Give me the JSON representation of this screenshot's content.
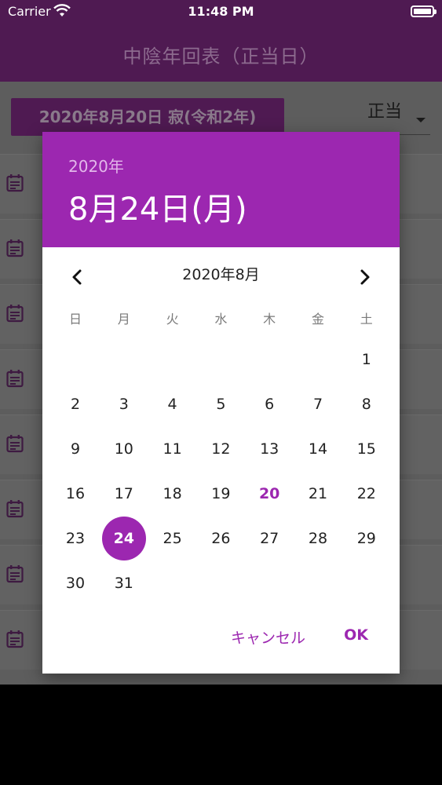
{
  "status_bar": {
    "carrier": "Carrier",
    "time": "11:48 PM"
  },
  "app_bar": {
    "title": "中陰年回表（正当日）"
  },
  "screen": {
    "date_button_label": "2020年8月20日 寂(令和2年)",
    "mode_select": {
      "selected": "正当"
    },
    "list_card_count": 8
  },
  "dialog": {
    "header_year": "2020年",
    "header_date": "8月24日(月)",
    "month_label": "2020年8月",
    "weekdays": [
      "日",
      "月",
      "火",
      "水",
      "木",
      "金",
      "土"
    ],
    "first_weekday_index": 6,
    "days_in_month": 31,
    "today": 20,
    "selected": 24,
    "cancel_label": "キャンセル",
    "ok_label": "OK"
  },
  "colors": {
    "primary": "#9c27b0",
    "app_bar": "#4f1a52"
  },
  "icons": [
    "wifi-icon",
    "battery-icon",
    "chevron-left-icon",
    "chevron-right-icon",
    "event-note-icon",
    "dropdown-arrow-icon"
  ]
}
